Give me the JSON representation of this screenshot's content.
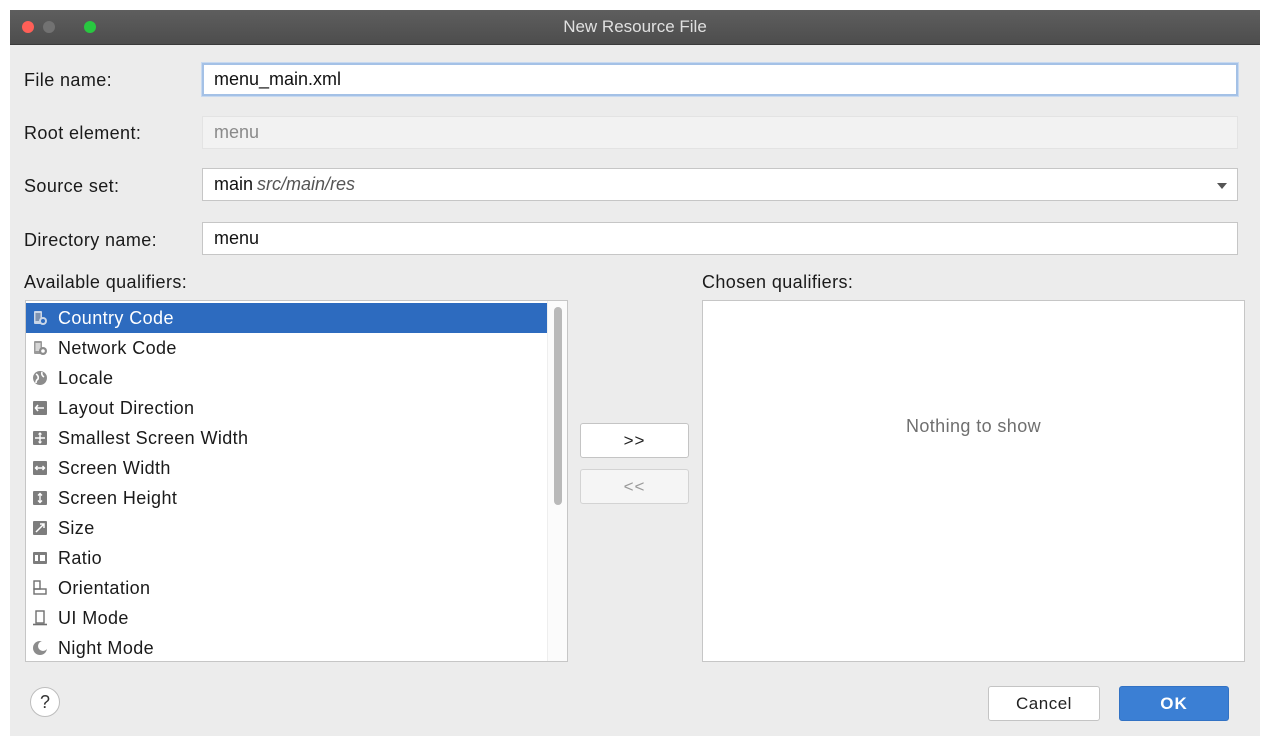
{
  "window": {
    "title": "New Resource File"
  },
  "form": {
    "file_name_label": "File name:",
    "file_name_value": "menu_main.xml",
    "root_element_label": "Root element:",
    "root_element_value": "menu",
    "source_set_label": "Source set:",
    "source_set_value": "main",
    "source_set_path": "src/main/res",
    "directory_name_label": "Directory name:",
    "directory_name_value": "menu"
  },
  "available": {
    "label": "Available qualifiers:",
    "items": [
      {
        "label": "Country Code",
        "icon": "country-code-icon",
        "selected": true
      },
      {
        "label": "Network Code",
        "icon": "network-code-icon"
      },
      {
        "label": "Locale",
        "icon": "globe-icon"
      },
      {
        "label": "Layout Direction",
        "icon": "layout-direction-icon"
      },
      {
        "label": "Smallest Screen Width",
        "icon": "smallest-screen-width-icon"
      },
      {
        "label": "Screen Width",
        "icon": "screen-width-icon"
      },
      {
        "label": "Screen Height",
        "icon": "screen-height-icon"
      },
      {
        "label": "Size",
        "icon": "size-icon"
      },
      {
        "label": "Ratio",
        "icon": "ratio-icon"
      },
      {
        "label": "Orientation",
        "icon": "orientation-icon"
      },
      {
        "label": "UI Mode",
        "icon": "ui-mode-icon"
      },
      {
        "label": "Night Mode",
        "icon": "night-mode-icon"
      }
    ]
  },
  "buttons": {
    "add": ">>",
    "remove": "<<",
    "cancel": "Cancel",
    "ok": "OK",
    "help": "?"
  },
  "chosen": {
    "label": "Chosen qualifiers:",
    "empty_text": "Nothing to show"
  },
  "colors": {
    "selection": "#2d6bbf",
    "primary_button": "#3b7fd4",
    "focus_ring": "#a4c1e6"
  }
}
